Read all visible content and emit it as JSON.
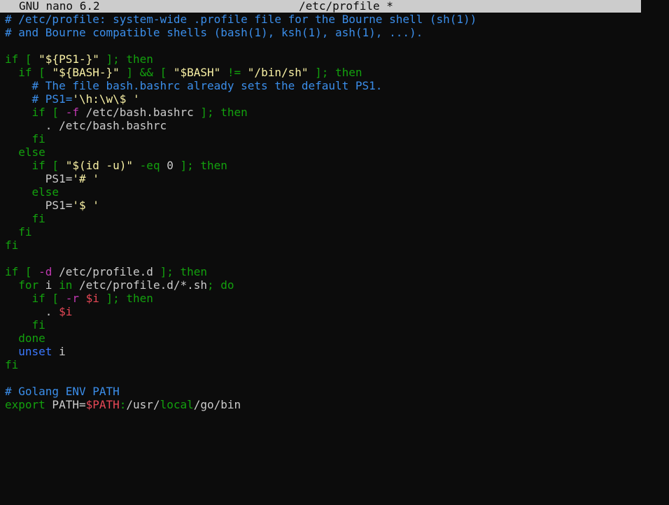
{
  "titlebar": {
    "app": "GNU nano 6.2",
    "file": "/etc/profile *"
  },
  "colors": {
    "background": "#0c0c0c",
    "titlebar": "#cccccc",
    "comment": "#3b8eea",
    "keyword": "#13a10e",
    "string": "#f9f1a5",
    "variable": "#e74856",
    "operator": "#c239b3",
    "plain": "#cccccc",
    "builtin": "#3b78ff"
  },
  "editor": {
    "lines": [
      [
        {
          "t": "# /etc/profile: system-wide .profile file for the Bourne shell (sh(1))",
          "c": "comment"
        }
      ],
      [
        {
          "t": "# and Bourne compatible shells (bash(1), ksh(1), ash(1), ...).",
          "c": "comment"
        }
      ],
      [],
      [
        {
          "t": "if [ ",
          "c": "keyword"
        },
        {
          "t": "\"${PS1-}\"",
          "c": "string"
        },
        {
          "t": " ]; then",
          "c": "keyword"
        }
      ],
      [
        {
          "t": "  if [ ",
          "c": "keyword"
        },
        {
          "t": "\"${BASH-}\"",
          "c": "string"
        },
        {
          "t": " ] && [ ",
          "c": "keyword"
        },
        {
          "t": "\"$BASH\"",
          "c": "string"
        },
        {
          "t": " != ",
          "c": "keyword"
        },
        {
          "t": "\"/bin/sh\"",
          "c": "string"
        },
        {
          "t": " ]; then",
          "c": "keyword"
        }
      ],
      [
        {
          "t": "    # The file bash.bashrc already sets the default PS1.",
          "c": "comment"
        }
      ],
      [
        {
          "t": "    # PS1=",
          "c": "comment"
        },
        {
          "t": "'\\h:\\w\\$ '",
          "c": "string"
        }
      ],
      [
        {
          "t": "    if [ ",
          "c": "keyword"
        },
        {
          "t": "-f",
          "c": "operator"
        },
        {
          "t": " /etc/bash.bashrc ",
          "c": "plain"
        },
        {
          "t": "]; then",
          "c": "keyword"
        }
      ],
      [
        {
          "t": "      . /etc/bash.bashrc",
          "c": "plain"
        }
      ],
      [
        {
          "t": "    fi",
          "c": "keyword"
        }
      ],
      [
        {
          "t": "  else",
          "c": "keyword"
        }
      ],
      [
        {
          "t": "    if [ ",
          "c": "keyword"
        },
        {
          "t": "\"$(id -u)\"",
          "c": "string"
        },
        {
          "t": " ",
          "c": "plain"
        },
        {
          "t": "-eq",
          "c": "keyword"
        },
        {
          "t": " 0 ",
          "c": "plain"
        },
        {
          "t": "]; then",
          "c": "keyword"
        }
      ],
      [
        {
          "t": "      PS1=",
          "c": "plain"
        },
        {
          "t": "'# '",
          "c": "string"
        }
      ],
      [
        {
          "t": "    else",
          "c": "keyword"
        }
      ],
      [
        {
          "t": "      PS1=",
          "c": "plain"
        },
        {
          "t": "'$ '",
          "c": "string"
        }
      ],
      [
        {
          "t": "    fi",
          "c": "keyword"
        }
      ],
      [
        {
          "t": "  fi",
          "c": "keyword"
        }
      ],
      [
        {
          "t": "fi",
          "c": "keyword"
        }
      ],
      [],
      [
        {
          "t": "if [ ",
          "c": "keyword"
        },
        {
          "t": "-d",
          "c": "operator"
        },
        {
          "t": " /etc/profile.d ",
          "c": "plain"
        },
        {
          "t": "]; then",
          "c": "keyword"
        }
      ],
      [
        {
          "t": "  for",
          "c": "keyword"
        },
        {
          "t": " i ",
          "c": "plain"
        },
        {
          "t": "in",
          "c": "keyword"
        },
        {
          "t": " /etc/profile.d/*.sh",
          "c": "plain"
        },
        {
          "t": "; do",
          "c": "keyword"
        }
      ],
      [
        {
          "t": "    if [ ",
          "c": "keyword"
        },
        {
          "t": "-r",
          "c": "operator"
        },
        {
          "t": " ",
          "c": "plain"
        },
        {
          "t": "$i",
          "c": "variable"
        },
        {
          "t": " ]; then",
          "c": "keyword"
        }
      ],
      [
        {
          "t": "      . ",
          "c": "plain"
        },
        {
          "t": "$i",
          "c": "variable"
        }
      ],
      [
        {
          "t": "    fi",
          "c": "keyword"
        }
      ],
      [
        {
          "t": "  done",
          "c": "keyword"
        }
      ],
      [
        {
          "t": "  unset",
          "c": "builtin"
        },
        {
          "t": " i",
          "c": "plain"
        }
      ],
      [
        {
          "t": "fi",
          "c": "keyword"
        }
      ],
      [],
      [
        {
          "t": "# Golang ENV PATH",
          "c": "comment"
        }
      ],
      [
        {
          "t": "export",
          "c": "keyword"
        },
        {
          "t": " PATH=",
          "c": "plain"
        },
        {
          "t": "$PATH",
          "c": "variable"
        },
        {
          "t": ":",
          "c": "keyword"
        },
        {
          "t": "/usr/",
          "c": "plain"
        },
        {
          "t": "local",
          "c": "keyword"
        },
        {
          "t": "/go/bin",
          "c": "plain"
        }
      ]
    ]
  }
}
